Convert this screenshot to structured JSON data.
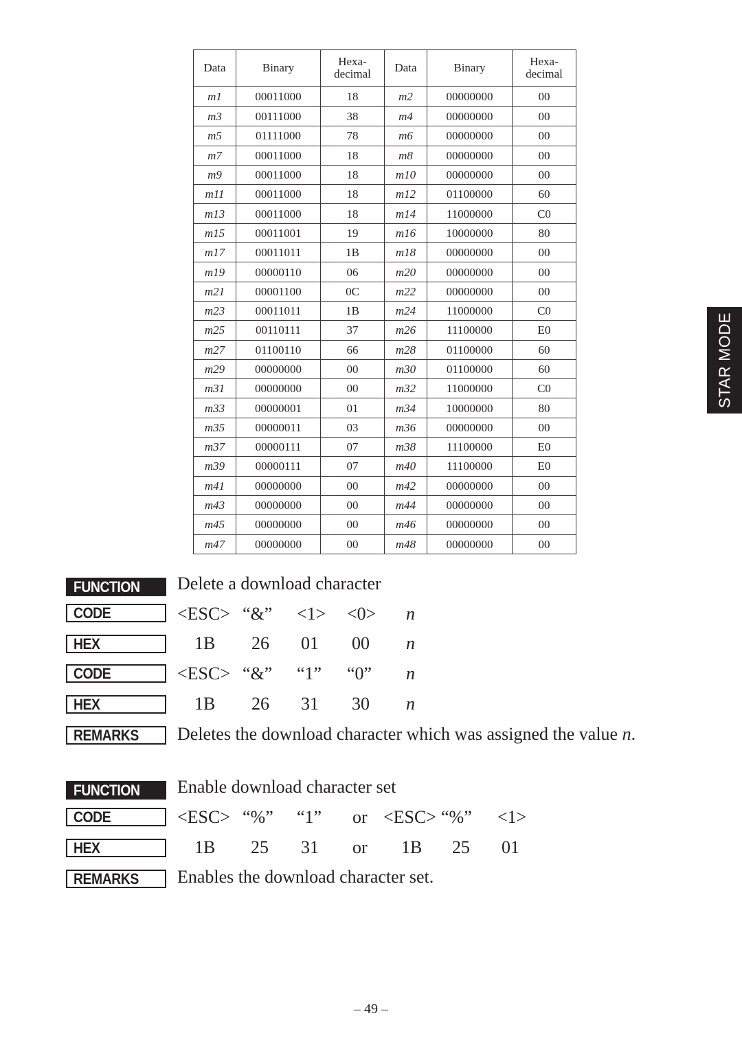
{
  "table": {
    "headers": [
      "Data",
      "Binary",
      "Hexa-\ndecimal",
      "Data",
      "Binary",
      "Hexa-\ndecimal"
    ],
    "header_hex_lines": [
      "Hexa-",
      "decimal"
    ],
    "rows": [
      [
        "m1",
        "00011000",
        "18",
        "m2",
        "00000000",
        "00"
      ],
      [
        "m3",
        "00111000",
        "38",
        "m4",
        "00000000",
        "00"
      ],
      [
        "m5",
        "01111000",
        "78",
        "m6",
        "00000000",
        "00"
      ],
      [
        "m7",
        "00011000",
        "18",
        "m8",
        "00000000",
        "00"
      ],
      [
        "m9",
        "00011000",
        "18",
        "m10",
        "00000000",
        "00"
      ],
      [
        "m11",
        "00011000",
        "18",
        "m12",
        "01100000",
        "60"
      ],
      [
        "m13",
        "00011000",
        "18",
        "m14",
        "11000000",
        "C0"
      ],
      [
        "m15",
        "00011001",
        "19",
        "m16",
        "10000000",
        "80"
      ],
      [
        "m17",
        "00011011",
        "1B",
        "m18",
        "00000000",
        "00"
      ],
      [
        "m19",
        "00000110",
        "06",
        "m20",
        "00000000",
        "00"
      ],
      [
        "m21",
        "00001100",
        "0C",
        "m22",
        "00000000",
        "00"
      ],
      [
        "m23",
        "00011011",
        "1B",
        "m24",
        "11000000",
        "C0"
      ],
      [
        "m25",
        "00110111",
        "37",
        "m26",
        "11100000",
        "E0"
      ],
      [
        "m27",
        "01100110",
        "66",
        "m28",
        "01100000",
        "60"
      ],
      [
        "m29",
        "00000000",
        "00",
        "m30",
        "01100000",
        "60"
      ],
      [
        "m31",
        "00000000",
        "00",
        "m32",
        "11000000",
        "C0"
      ],
      [
        "m33",
        "00000001",
        "01",
        "m34",
        "10000000",
        "80"
      ],
      [
        "m35",
        "00000011",
        "03",
        "m36",
        "00000000",
        "00"
      ],
      [
        "m37",
        "00000111",
        "07",
        "m38",
        "11100000",
        "E0"
      ],
      [
        "m39",
        "00000111",
        "07",
        "m40",
        "11100000",
        "E0"
      ],
      [
        "m41",
        "00000000",
        "00",
        "m42",
        "00000000",
        "00"
      ],
      [
        "m43",
        "00000000",
        "00",
        "m44",
        "00000000",
        "00"
      ],
      [
        "m45",
        "00000000",
        "00",
        "m46",
        "00000000",
        "00"
      ],
      [
        "m47",
        "00000000",
        "00",
        "m48",
        "00000000",
        "00"
      ]
    ]
  },
  "side_tab": "STAR MODE",
  "labels": {
    "function": "FUNCTION",
    "code": "CODE",
    "hex": "HEX",
    "remarks": "REMARKS"
  },
  "commands": [
    {
      "function": "Delete a download character",
      "code_rows": [
        [
          "<ESC>",
          "“&”",
          "<1>",
          "<0>",
          "n"
        ],
        [
          "1B",
          "26",
          "01",
          "00",
          "n"
        ],
        [
          "<ESC>",
          "“&”",
          "“1”",
          "“0”",
          "n"
        ],
        [
          "1B",
          "26",
          "31",
          "30",
          "n"
        ]
      ],
      "remarks_prefix": "Deletes the download character which was assigned the value ",
      "remarks_var": "n",
      "remarks_suffix": "."
    },
    {
      "function": "Enable download character set",
      "code_rows": [
        [
          "<ESC>",
          "“%”",
          "“1”",
          "or",
          "<ESC>",
          "“%”",
          "<1>"
        ],
        [
          "1B",
          "25",
          "31",
          "or",
          "1B",
          "25",
          "01"
        ]
      ],
      "remarks": "Enables the download character set."
    }
  ],
  "page_number": "– 49 –"
}
